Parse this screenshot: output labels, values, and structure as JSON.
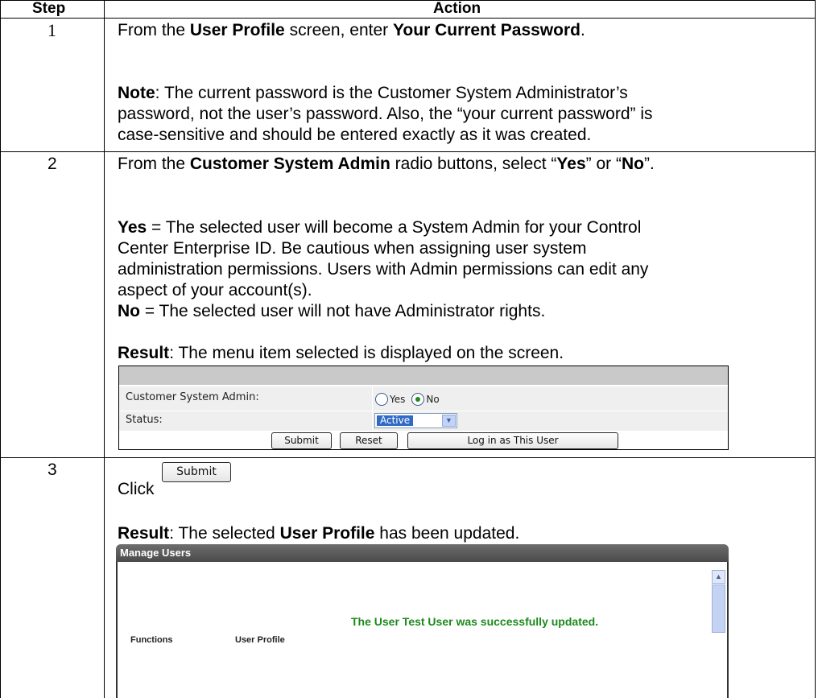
{
  "table": {
    "header": {
      "step": "Step",
      "action": "Action"
    },
    "rows": [
      {
        "step": "1",
        "line1": {
          "pre": "From the ",
          "b1": "User Profile",
          "mid": " screen, enter ",
          "b2": "Your Current Password",
          "post": "."
        },
        "note": {
          "label": "Note",
          "l1": ":  The current password is the Customer System Administrator’s",
          "l2": "password, not the user’s password.  Also, the “your current password” is",
          "l3": "case-sensitive and should be entered exactly as it was created."
        }
      },
      {
        "step": "2",
        "line1": {
          "pre": "From the ",
          "b1": "Customer System Admin",
          "mid": " radio buttons, select “",
          "b2": "Yes",
          "mid2": "” or “",
          "b3": "No",
          "post": "”."
        },
        "yes": {
          "label": "Yes",
          "l1": " = The selected user will become a System Admin for your Control",
          "l2": "Center Enterprise ID.  Be cautious when assigning user system",
          "l3": "administration permissions.  Users with Admin permissions can edit any",
          "l4": "aspect of your account(s)."
        },
        "no": {
          "label": "No",
          "text": " = The selected user will not have Administrator rights."
        },
        "result": {
          "label": "Result",
          "text": ":  The menu item selected is displayed on the screen."
        },
        "screenshot": {
          "admin_label": "Customer System Admin:",
          "yes_option": "Yes",
          "no_option": "No",
          "selected_option": "No",
          "status_label": "Status:",
          "status_value": "Active",
          "submit": "Submit",
          "reset": "Reset",
          "login_as": "Log in as This User"
        }
      },
      {
        "step": "3",
        "click": "Click",
        "submit_button": "Submit",
        "result": {
          "label": "Result",
          "pre": ":  The selected ",
          "b": "User Profile",
          "post": " has been updated."
        },
        "screenshot": {
          "title": "Manage Users",
          "message": "The User Test User was successfully updated.",
          "functions": "Functions",
          "user_profile": "User Profile"
        }
      }
    ]
  }
}
